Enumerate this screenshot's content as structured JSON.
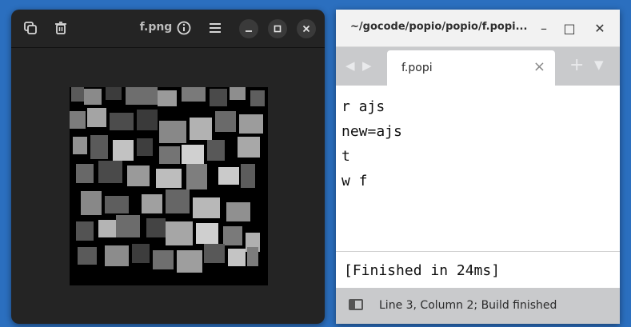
{
  "viewer": {
    "title": "f.png",
    "buttons": {
      "copy": "copy-icon",
      "delete": "trash-icon",
      "info": "info-icon",
      "menu": "hamburger-menu-icon",
      "minimize": "minimize-icon",
      "maximize": "maximize-icon",
      "close": "close-icon"
    },
    "image": "scrambled grayscale photo tiles on black background"
  },
  "editor": {
    "title": "~/gocode/popio/popio/f.popi...",
    "tab": {
      "label": "f.popi",
      "close": "×"
    },
    "tabbar_icons": {
      "back": "◀",
      "forward": "▶",
      "new_tab": "+",
      "tab_menu": "▼"
    },
    "window_controls": {
      "minimize": "–",
      "maximize": "□",
      "close": "✕"
    },
    "code_lines": [
      "r ajs",
      "new=ajs",
      "t",
      "w f"
    ],
    "output": "[Finished in 24ms]",
    "status": "Line 3, Column 2; Build finished"
  }
}
